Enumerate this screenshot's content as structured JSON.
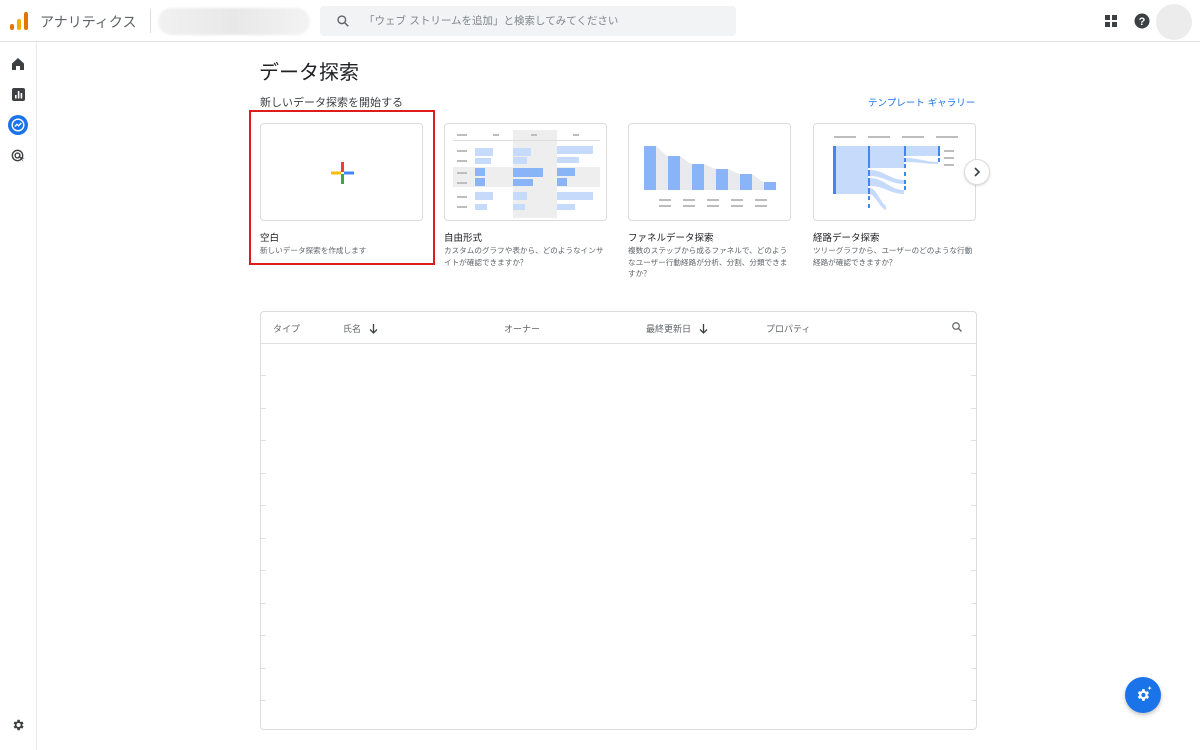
{
  "app": {
    "title": "アナリティクス"
  },
  "search": {
    "placeholder": "「ウェブ ストリームを追加」と検索してみてください"
  },
  "page": {
    "title": "データ探索",
    "section_label": "新しいデータ探索を開始する",
    "gallery_link": "テンプレート ギャラリー"
  },
  "templates": [
    {
      "title": "空白",
      "description": "新しいデータ探索を作成します"
    },
    {
      "title": "自由形式",
      "description": "カスタムのグラフや表から、どのようなインサイトが確認できますか？"
    },
    {
      "title": "ファネルデータ探索",
      "description": "複数のステップから成るファネルで、どのようなユーザー行動経路が分析、分割、分類できますか？"
    },
    {
      "title": "経路データ探索",
      "description": "ツリーグラフから、ユーザーのどのような行動経路が確認できますか？"
    }
  ],
  "table": {
    "columns": {
      "type": "タイプ",
      "name": "氏名",
      "owner": "オーナー",
      "updated": "最終更新日",
      "property": "プロパティ"
    }
  },
  "colors": {
    "accent": "#1a73e8",
    "highlight": "#e01b1b",
    "chart_blue": "#8ab4f8"
  }
}
